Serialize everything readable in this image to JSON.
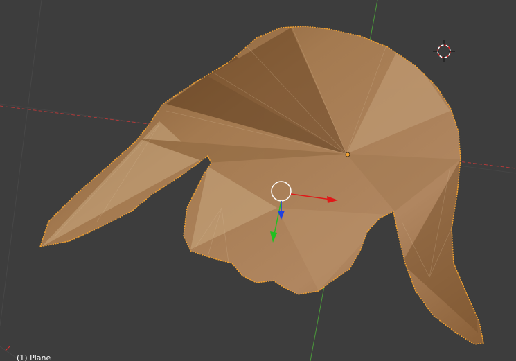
{
  "viewport": {
    "object_label": "(1) Plane"
  },
  "colors": {
    "background": "#3d3d3d",
    "grid": "#474747",
    "axis_x": "#b03a3a",
    "axis_y": "#4a9a3a",
    "selection_outline": "#f0a030",
    "mesh_base": "#9a7049",
    "gizmo_x": "#e01818",
    "gizmo_y": "#20c020",
    "gizmo_z": "#2040e0",
    "cursor_ring": "#ffffff"
  },
  "icons": {
    "cursor": "3d-cursor-icon",
    "origin": "object-origin-icon",
    "gizmo": "transform-manipulator-icon"
  }
}
